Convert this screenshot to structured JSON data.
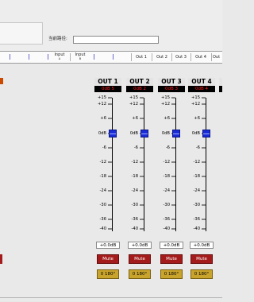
{
  "toolbar": {
    "path_label": "当前路径:",
    "path_value": ""
  },
  "routing_bar": {
    "input_labels": [
      {
        "text": "Input",
        "sub": "A"
      },
      {
        "text": "Input",
        "sub": "B"
      }
    ],
    "output_labels": [
      "Out 1",
      "Out 2",
      "Out 3",
      "Out 4",
      "Out"
    ]
  },
  "meter_scale": [
    "+15",
    "+12",
    "+6",
    "0dB",
    "-6",
    "-12",
    "-18",
    "-24",
    "-30",
    "-36",
    "-40"
  ],
  "channels": [
    {
      "name": "OUT 1",
      "meter": "0dB 5",
      "gain": "+0.0dB",
      "mute": "Mute",
      "phase": "0 180°",
      "fader_db": 0
    },
    {
      "name": "OUT 2",
      "meter": "0dB 2",
      "gain": "+0.0dB",
      "mute": "Mute",
      "phase": "0 180°",
      "fader_db": 0
    },
    {
      "name": "OUT 3",
      "meter": "0dB 3",
      "gain": "+0.0dB",
      "mute": "Mute",
      "phase": "0 180°",
      "fader_db": 0
    },
    {
      "name": "OUT 4",
      "meter": "0dB 4",
      "gain": "+0.0dB",
      "mute": "Mute",
      "phase": "0 180°",
      "fader_db": 0
    }
  ],
  "colors": {
    "mute": "#a41b1b",
    "phase": "#c9a42c",
    "fader_knob": "#1a2cd8",
    "meter_bg": "#000000",
    "meter_text": "#ff2020"
  }
}
